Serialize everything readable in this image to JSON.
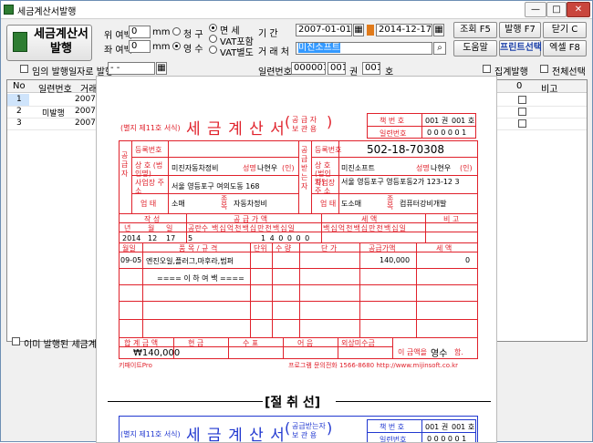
{
  "window": {
    "title": "세금계산서발행",
    "min": "—",
    "max": "□",
    "close": "✕"
  },
  "toolbar": {
    "main_button": "세금계산서\n발행",
    "main_button_l1": "세금계산서",
    "main_button_l2": "발행",
    "margin_top_label": "위 여백",
    "margin_top": "0",
    "margin_left_label": "좌 여백",
    "margin_left": "0",
    "unit": "mm",
    "receipt_label": "청 구",
    "receipt_value": "영 수",
    "tax_opts": [
      "면   세",
      "VAT포함",
      "VAT별도"
    ],
    "period_label": "기    간",
    "date_from": "2007-01-01",
    "date_to": "2014-12-17",
    "client_label": "거 래 처",
    "client_value": "미진소프트",
    "view_btn": "조회 F5",
    "issue_btn": "발행 F7",
    "close_btn": "닫기 C",
    "help_btn": "도움말",
    "print_select_btn": "프린트선택",
    "excel_btn": "엑셀 F8",
    "anydate_label": "임의 발행일자로 발행",
    "anydate_value": "  -  -",
    "serial_label": "일련번호:",
    "serial_value": "000001",
    "vol_value": "001",
    "vol_label": "권",
    "num_value": "001",
    "num_label": "호",
    "total_issue_label": "집계발행",
    "select_all_label": "전체선택"
  },
  "grid": {
    "headers": [
      "No",
      "일련번호",
      "거래처",
      "0",
      "비고"
    ],
    "rows": [
      {
        "no": "1",
        "serial": "",
        "date": "2007-0"
      },
      {
        "no": "2",
        "serial": "미발행",
        "date": "2007-0"
      },
      {
        "no": "3",
        "serial": "",
        "date": "2007-1"
      }
    ],
    "footer_check_label": "이미 발행된 세금계산서"
  },
  "invoice": {
    "form_no": "(별지 제11호 서식)",
    "title": "세 금 계 산 서",
    "title_sub1": "공 급 자",
    "title_sub2": "보 관 용",
    "book_label": "책 번 호",
    "book_vol": "001 권",
    "book_num": "001 호",
    "serial_label": "일련번호",
    "serial_digits": "0 0 0 0 0 1",
    "supplier": "공급자",
    "receiver": "공급받는자",
    "reg_label": "등록번호",
    "reg_recv": "502-18-70308",
    "company_label": "상 호\n(법인명)",
    "company_sup": "미진자동차정비",
    "company_recv": "미진소프트",
    "name_label": "성명",
    "name_sup": "나현우",
    "name_recv": "나현우",
    "seal": "(인)",
    "addr_label": "사업장\n주 소",
    "addr_sup": "서울 영등포구 여의도동 168",
    "addr_recv": "서울 영등포구 영등포동2가 123-12 3",
    "biz_label": "업 태",
    "biz_sup": "소매",
    "biz_recv": "도소매",
    "item_label": "종목",
    "item_sup": "자동차정비",
    "item_recv": "컴퓨터강비개발",
    "hdr_date": "작 성",
    "hdr_supply": "공 급 가 액",
    "hdr_tax": "세 액",
    "hdr_note": "비 고",
    "date_cols": [
      "년",
      "월",
      "일"
    ],
    "blank_cols": "공란수",
    "digits": "백십억천백십만천백십일",
    "year": "2014",
    "month": "12",
    "day": "17",
    "blank": "5",
    "amount": "1 4 0 0 0 0",
    "items_hdr": [
      "월일",
      "품 목 / 규 격",
      "단위",
      "수 량",
      "단 가",
      "공급가액",
      "세 액"
    ],
    "item_date": "09-05",
    "item_name": "엔진오일,플러그,마후라,범퍼",
    "item_amount": "140,000",
    "item_tax": "0",
    "end_mark": "==== 이 하 여 백 ====",
    "sum_hdr": [
      "합 계 금 액",
      "현 금",
      "수 표",
      "어 음",
      "외상미수금"
    ],
    "sum_value": "₩140,000",
    "claim_text": "이 금액을 영수 함.",
    "claim_pre": "이 금액을",
    "claim_word": "영수",
    "claim_post": "함.",
    "footer_left": "키패이트Pro",
    "footer_right": "프로그램 문의전화 1566-8680 http://www.mijinsoft.co.kr",
    "cut_line": "[절 취 선]",
    "title2": "세 금 계 산 서",
    "title2_sub1": "공급받는자",
    "title2_sub2": "보 관 용"
  },
  "colors": {
    "red": "#e0212b",
    "blue": "#2138d0"
  }
}
